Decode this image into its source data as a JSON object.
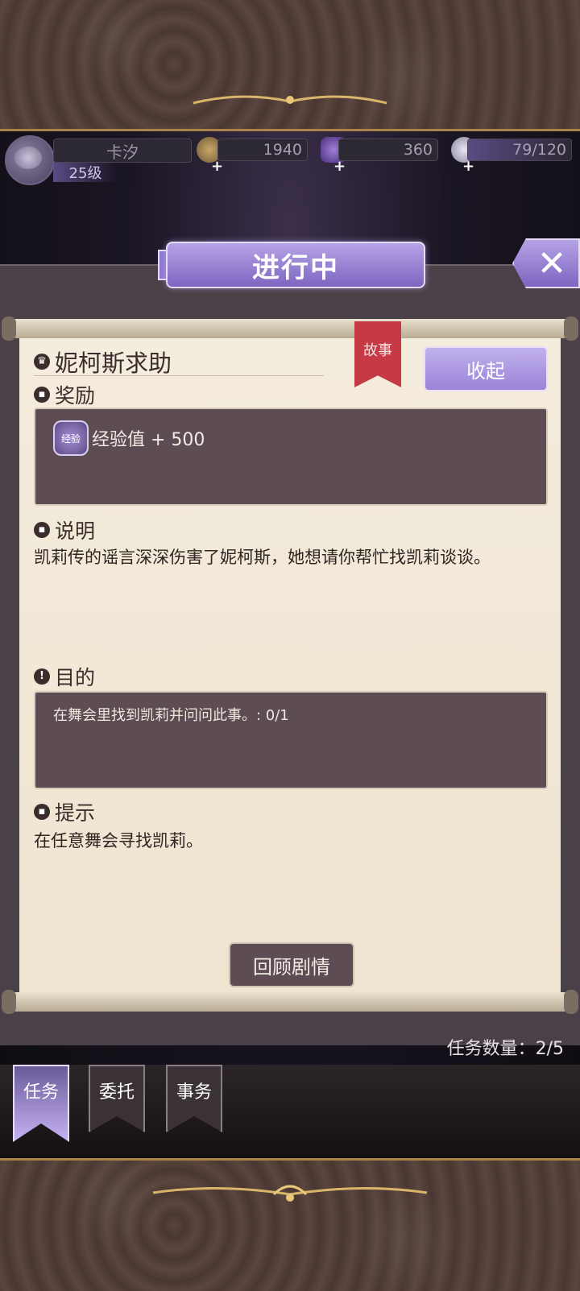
{
  "player": {
    "name": "卡汐",
    "level": "25级",
    "coins": "1940",
    "gems": "360",
    "stamina": "79/120"
  },
  "header": {
    "title": "进行中",
    "close_label": "✕"
  },
  "quest": {
    "name": "妮柯斯求助",
    "tag": "故事",
    "collapse_label": "收起",
    "reward_heading": "奖励",
    "reward_icon_label": "经验",
    "reward_text": "经验值 + 500",
    "desc_heading": "说明",
    "desc_text": "凯莉传的谣言深深伤害了妮柯斯，她想请你帮忙找凯莉谈谈。",
    "goal_heading": "目的",
    "goal_text": "在舞会里找到凯莉并问问此事。: 0/1",
    "hint_heading": "提示",
    "hint_text": "在任意舞会寻找凯莉。",
    "review_label": "回顾剧情"
  },
  "task_count": "任务数量：2/5",
  "tabs": [
    {
      "label": "任务",
      "active": true
    },
    {
      "label": "委托",
      "active": false
    },
    {
      "label": "事务",
      "active": false
    }
  ],
  "colors": {
    "accent_purple": "#9a84d8",
    "tag_red": "#c53a45",
    "paper": "#f4ecdd",
    "box_fill": "#5e4c55"
  }
}
